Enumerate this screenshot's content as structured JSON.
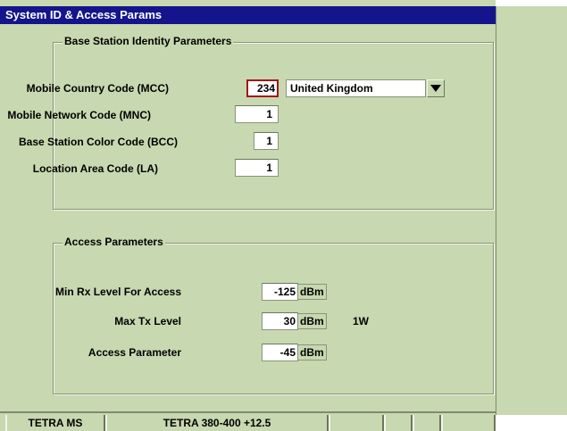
{
  "window": {
    "title": "System ID & Access Params"
  },
  "identity": {
    "title": "Base Station Identity Parameters",
    "mcc_label": "Mobile Country Code (MCC)",
    "mcc_value": "234",
    "country": "United Kingdom",
    "mnc_label": "Mobile Network Code (MNC)",
    "mnc_value": "1",
    "bcc_label": "Base Station Color Code (BCC)",
    "bcc_value": "1",
    "la_label": "Location Area Code (LA)",
    "la_value": "1"
  },
  "access": {
    "title": "Access Parameters",
    "min_rx_label": "Min Rx Level For Access",
    "min_rx_value": "-125",
    "min_rx_unit": "dBm",
    "max_tx_label": "Max Tx Level",
    "max_tx_value": "30",
    "max_tx_unit": "dBm",
    "max_tx_note": "1W",
    "access_param_label": "Access Parameter",
    "access_param_value": "-45",
    "access_param_unit": "dBm"
  },
  "statusbar": {
    "mode": "TETRA MS",
    "band": "TETRA 380-400 +12.5",
    "cell3": "",
    "cell4": "",
    "cell5": "",
    "cell6": ""
  },
  "colors": {
    "titlebar": "#14148c",
    "panel": "#c8d8b0",
    "active_border": "#a01818"
  },
  "icons": {
    "dropdown": "triangle-down-icon"
  }
}
